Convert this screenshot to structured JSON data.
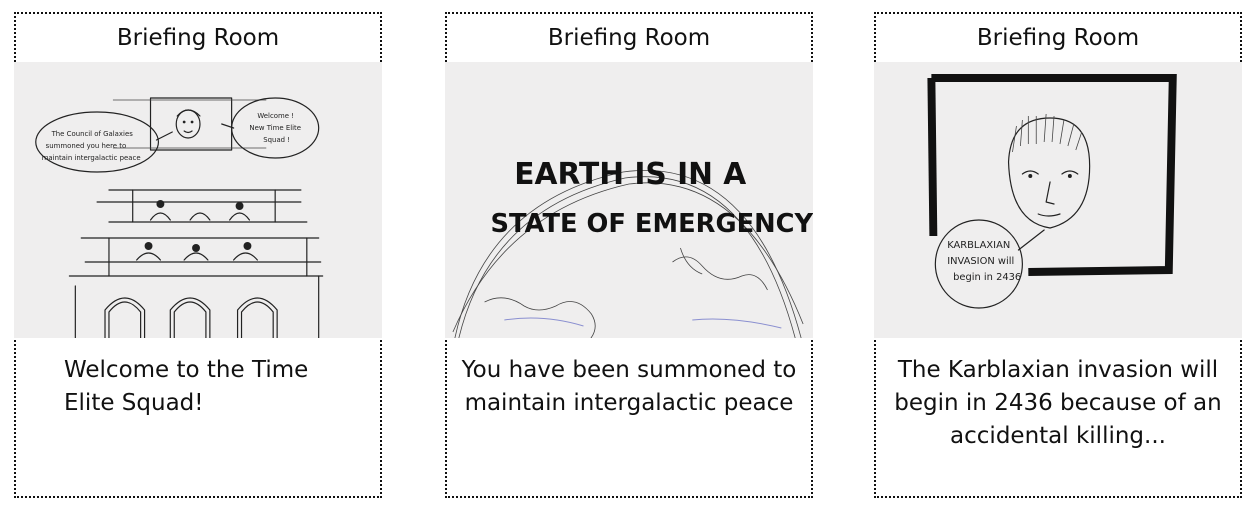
{
  "panels": [
    {
      "title": "Briefing Room",
      "image_text": {
        "bubble_left": [
          "The Council of Galaxies",
          "summoned you here to",
          "maintain intergalactic peace"
        ],
        "bubble_right": [
          "Welcome !",
          "New Time Elite",
          "Squad !"
        ]
      },
      "caption": "Welcome to the Time Elite Squad!"
    },
    {
      "title": "Briefing Room",
      "image_text": {
        "headline_line1": "EARTH IS IN A",
        "headline_line2": "STATE OF EMERGENCY!"
      },
      "caption": "You have been summoned to maintain intergalactic peace"
    },
    {
      "title": "Briefing Room",
      "image_text": {
        "bubble": [
          "KARBLAXIAN",
          "INVASION will",
          "begin in 2436"
        ]
      },
      "caption": "The Karblaxian invasion will begin in 2436 because of an accidental killing..."
    }
  ]
}
